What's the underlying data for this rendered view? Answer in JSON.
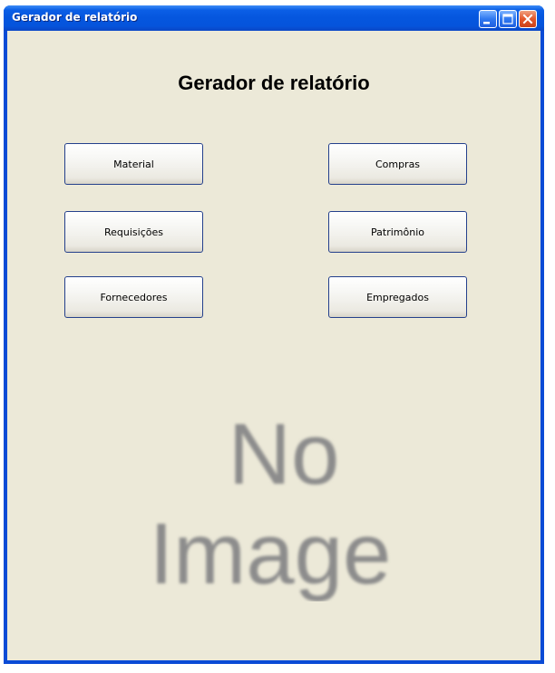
{
  "window": {
    "title": "Gerador de relatório",
    "controls": {
      "minimize": "minimize-icon",
      "maximize": "maximize-icon",
      "close": "close-icon"
    }
  },
  "main": {
    "heading": "Gerador de relatório",
    "buttons": [
      {
        "label": "Material"
      },
      {
        "label": "Compras"
      },
      {
        "label": "Requisições"
      },
      {
        "label": "Patrimônio"
      },
      {
        "label": "Fornecedores"
      },
      {
        "label": "Empregados"
      }
    ],
    "image_placeholder": {
      "line1": "No",
      "line2": "Image"
    }
  },
  "colors": {
    "titlebar": "#0556de",
    "client_bg": "#ece9d8",
    "button_border": "#24408c",
    "placeholder_text": "#8c8c8c",
    "close_button": "#e4572b"
  }
}
